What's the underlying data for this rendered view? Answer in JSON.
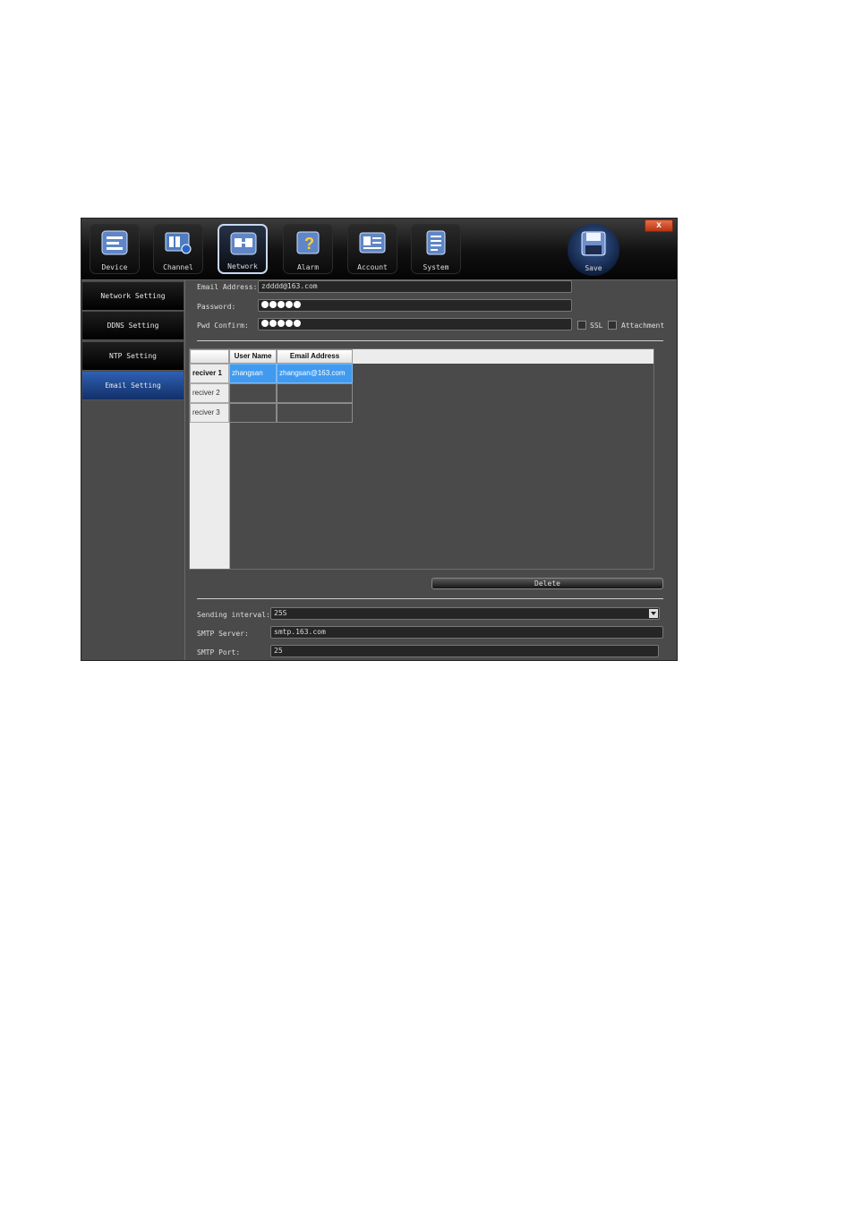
{
  "window": {
    "close_label": "x"
  },
  "toolbar": {
    "items": [
      {
        "label": "Device",
        "icon": "device-list-icon"
      },
      {
        "label": "Channel",
        "icon": "channel-film-icon"
      },
      {
        "label": "Network",
        "icon": "network-icon"
      },
      {
        "label": "Alarm",
        "icon": "alarm-icon"
      },
      {
        "label": "Account",
        "icon": "account-card-icon"
      },
      {
        "label": "System",
        "icon": "system-document-icon"
      }
    ],
    "active": "Network",
    "save_label": "Save"
  },
  "sidebar": {
    "items": [
      {
        "label": "Network Setting"
      },
      {
        "label": "DDNS Setting"
      },
      {
        "label": "NTP Setting"
      },
      {
        "label": "Email Setting"
      }
    ],
    "active": "Email Setting"
  },
  "email": {
    "address_label": "Email Address:",
    "address_value": "zdddd@163.com",
    "password_label": "Password:",
    "password_length": 5,
    "confirm_label": "Pwd Confirm:",
    "confirm_length": 5,
    "ssl_label": "SSL",
    "attachment_label": "Attachment"
  },
  "receivers": {
    "columns": [
      "User Name",
      "Email Address"
    ],
    "rows": [
      {
        "header": "reciver 1",
        "user": "zhangsan",
        "email": "zhangsan@163.com",
        "selected": true
      },
      {
        "header": "reciver 2",
        "user": "",
        "email": "",
        "selected": false
      },
      {
        "header": "reciver 3",
        "user": "",
        "email": "",
        "selected": false
      }
    ]
  },
  "delete_label": "Delete",
  "sending": {
    "interval_label": "Sending interval:",
    "interval_value": "25S",
    "smtp_server_label": "SMTP Server:",
    "smtp_server_value": "smtp.163.com",
    "smtp_port_label": "SMTP Port:",
    "smtp_port_value": "25"
  },
  "colors": {
    "accent": "#2f60b4",
    "selection": "#3f9af0",
    "panel": "#4a4a4a"
  }
}
